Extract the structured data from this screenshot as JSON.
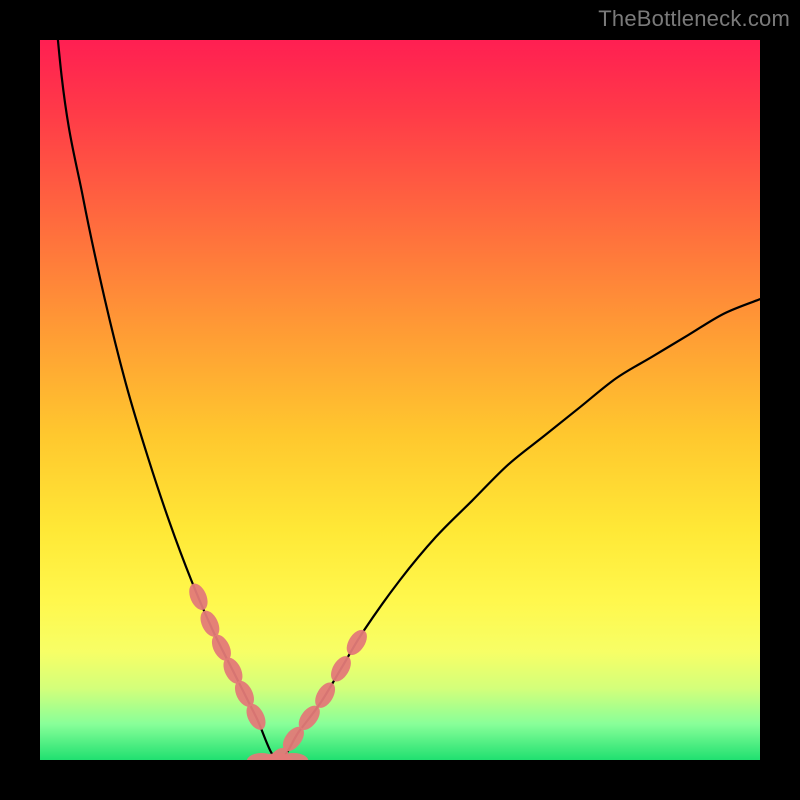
{
  "watermark": {
    "text": "TheBottleneck.com"
  },
  "colors": {
    "background": "#000000",
    "curve": "#000000",
    "pill": "#e37a78",
    "gradient_top": "#ff1f52",
    "gradient_bottom": "#20e070"
  },
  "chart_data": {
    "type": "line",
    "title": "",
    "xlabel": "",
    "ylabel": "",
    "xlim": [
      0,
      100
    ],
    "ylim": [
      0,
      100
    ],
    "grid": false,
    "legend": false,
    "note": "V-shaped bottleneck curve; x is roughly relative performance, y is mismatch %. Minimum ~ x=33, y=0.",
    "x": [
      0,
      3,
      6,
      9,
      12,
      15,
      18,
      21,
      24,
      27,
      30,
      33,
      36,
      39,
      42,
      45,
      50,
      55,
      60,
      65,
      70,
      75,
      80,
      85,
      90,
      95,
      100
    ],
    "y": [
      130,
      95,
      78,
      64,
      52,
      42,
      33,
      25,
      18,
      12,
      6,
      0,
      4,
      8,
      13,
      18,
      25,
      31,
      36,
      41,
      45,
      49,
      53,
      56,
      59,
      62,
      64
    ],
    "highlight_ranges_x": [
      [
        22,
        30
      ],
      [
        33,
        44
      ]
    ]
  }
}
